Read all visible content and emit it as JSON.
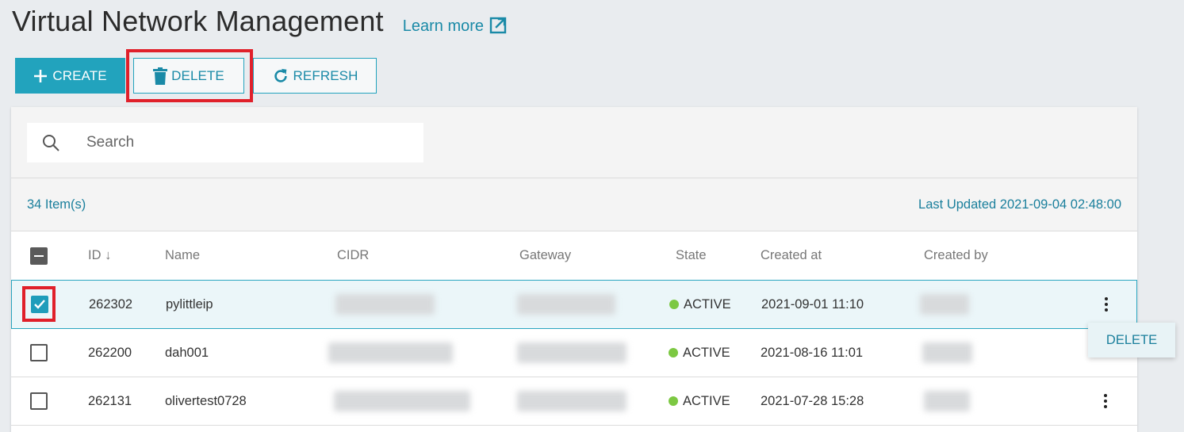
{
  "header": {
    "title": "Virtual Network Management",
    "learn_more": "Learn more"
  },
  "toolbar": {
    "create_label": "CREATE",
    "delete_label": "DELETE",
    "refresh_label": "REFRESH"
  },
  "search": {
    "placeholder": "Search"
  },
  "meta": {
    "item_count": "34 Item(s)",
    "last_updated": "Last Updated 2021-09-04 02:48:00"
  },
  "table": {
    "columns": [
      "ID ↓",
      "Name",
      "CIDR",
      "Gateway",
      "State",
      "Created at",
      "Created by"
    ],
    "rows": [
      {
        "id": "262302",
        "name": "pylittleip",
        "state": "ACTIVE",
        "created_at": "2021-09-01 11:10",
        "checked": true,
        "selected": true
      },
      {
        "id": "262200",
        "name": "dah001",
        "state": "ACTIVE",
        "created_at": "2021-08-16 11:01",
        "checked": false,
        "selected": false
      },
      {
        "id": "262131",
        "name": "olivertest0728",
        "state": "ACTIVE",
        "created_at": "2021-07-28 15:28",
        "checked": false,
        "selected": false
      }
    ]
  },
  "context_menu": {
    "delete_label": "DELETE"
  },
  "colors": {
    "accent": "#22a3bd",
    "highlight": "#e0202a",
    "active_dot": "#7cc842"
  }
}
